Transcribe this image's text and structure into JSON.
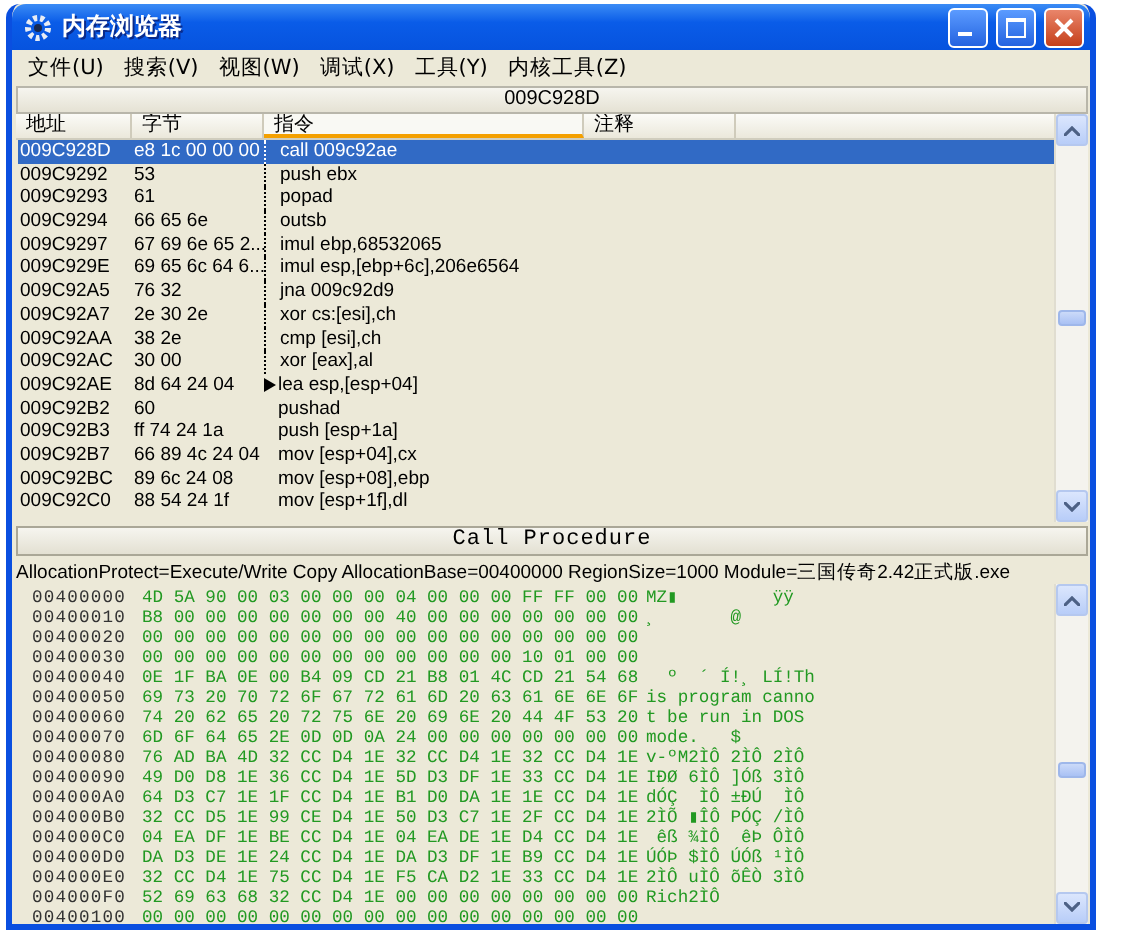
{
  "window": {
    "title": "内存浏览器"
  },
  "menu": [
    {
      "label": "文件(U)"
    },
    {
      "label": "搜索(V)"
    },
    {
      "label": "视图(W)"
    },
    {
      "label": "调试(X)"
    },
    {
      "label": "工具(Y)"
    },
    {
      "label": "内核工具(Z)"
    }
  ],
  "disassembler": {
    "address": "009C928D",
    "columns": [
      {
        "label": "地址",
        "highlighted": false
      },
      {
        "label": "字节",
        "highlighted": false
      },
      {
        "label": "指令",
        "highlighted": true
      },
      {
        "label": "注释",
        "highlighted": false
      }
    ],
    "rows": [
      {
        "address": "009C928D",
        "bytes": "e8 1c 00 00 00",
        "instruction": "call 009c92ae",
        "selected": true,
        "jump_line": true,
        "jump_target": false
      },
      {
        "address": "009C9292",
        "bytes": "53",
        "instruction": "push ebx",
        "selected": false,
        "jump_line": true,
        "jump_target": false
      },
      {
        "address": "009C9293",
        "bytes": "61",
        "instruction": "popad",
        "selected": false,
        "jump_line": true,
        "jump_target": false
      },
      {
        "address": "009C9294",
        "bytes": "66 65 6e",
        "instruction": "outsb",
        "selected": false,
        "jump_line": true,
        "jump_target": false
      },
      {
        "address": "009C9297",
        "bytes": "67 69 6e 65 2...",
        "instruction": "imul ebp,68532065",
        "selected": false,
        "jump_line": true,
        "jump_target": false
      },
      {
        "address": "009C929E",
        "bytes": "69 65 6c 64 6...",
        "instruction": "imul esp,[ebp+6c],206e6564",
        "selected": false,
        "jump_line": true,
        "jump_target": false
      },
      {
        "address": "009C92A5",
        "bytes": "76 32",
        "instruction": "jna 009c92d9",
        "selected": false,
        "jump_line": true,
        "jump_target": false
      },
      {
        "address": "009C92A7",
        "bytes": "2e 30 2e",
        "instruction": "xor cs:[esi],ch",
        "selected": false,
        "jump_line": true,
        "jump_target": false
      },
      {
        "address": "009C92AA",
        "bytes": "38 2e",
        "instruction": "cmp [esi],ch",
        "selected": false,
        "jump_line": true,
        "jump_target": false
      },
      {
        "address": "009C92AC",
        "bytes": "30 00",
        "instruction": "xor [eax],al",
        "selected": false,
        "jump_line": true,
        "jump_target": false
      },
      {
        "address": "009C92AE",
        "bytes": "8d 64 24 04",
        "instruction": "lea esp,[esp+04]",
        "selected": false,
        "jump_line": false,
        "jump_target": true
      },
      {
        "address": "009C92B2",
        "bytes": "60",
        "instruction": "pushad",
        "selected": false,
        "jump_line": false,
        "jump_target": false
      },
      {
        "address": "009C92B3",
        "bytes": "ff 74 24 1a",
        "instruction": "push [esp+1a]",
        "selected": false,
        "jump_line": false,
        "jump_target": false
      },
      {
        "address": "009C92B7",
        "bytes": "66 89 4c 24 04",
        "instruction": "mov [esp+04],cx",
        "selected": false,
        "jump_line": false,
        "jump_target": false
      },
      {
        "address": "009C92BC",
        "bytes": "89 6c 24 08",
        "instruction": "mov [esp+08],ebp",
        "selected": false,
        "jump_line": false,
        "jump_target": false
      },
      {
        "address": "009C92C0",
        "bytes": "88 54 24 1f",
        "instruction": "mov [esp+1f],dl",
        "selected": false,
        "jump_line": false,
        "jump_target": false
      }
    ]
  },
  "section_bar": {
    "label": "Call Procedure"
  },
  "hex": {
    "info": "AllocationProtect=Execute/Write Copy  AllocationBase=00400000 RegionSize=1000 Module=三国传奇2.42正式版.exe",
    "rows": [
      {
        "address": "00400000",
        "bytes": "4D 5A 90 00 03 00 00 00 04 00 00 00 FF FF 00 00",
        "ascii": "MZ▮         ÿÿ"
      },
      {
        "address": "00400010",
        "bytes": "B8 00 00 00 00 00 00 00 40 00 00 00 00 00 00 00",
        "ascii": "¸       @"
      },
      {
        "address": "00400020",
        "bytes": "00 00 00 00 00 00 00 00 00 00 00 00 00 00 00 00"
      },
      {
        "address": "00400030",
        "bytes": "00 00 00 00 00 00 00 00 00 00 00 00 10 01 00 00"
      },
      {
        "address": "00400040",
        "bytes": "0E 1F BA 0E 00 B4 09 CD 21 B8 01 4C CD 21 54 68",
        "ascii": "  º  ´ Í!¸ LÍ!Th"
      },
      {
        "address": "00400050",
        "bytes": "69 73 20 70 72 6F 67 72 61 6D 20 63 61 6E 6E 6F",
        "ascii": "is program canno"
      },
      {
        "address": "00400060",
        "bytes": "74 20 62 65 20 72 75 6E 20 69 6E 20 44 4F 53 20",
        "ascii": "t be run in DOS"
      },
      {
        "address": "00400070",
        "bytes": "6D 6F 64 65 2E 0D 0D 0A 24 00 00 00 00 00 00 00",
        "ascii": "mode.   $"
      },
      {
        "address": "00400080",
        "bytes": "76 AD BA 4D 32 CC D4 1E 32 CC D4 1E 32 CC D4 1E",
        "ascii": "v-ºM2ÌÔ 2ÌÔ 2ÌÔ"
      },
      {
        "address": "00400090",
        "bytes": "49 D0 D8 1E 36 CC D4 1E 5D D3 DF 1E 33 CC D4 1E",
        "ascii": "IÐØ 6ÌÔ ]Óß 3ÌÔ"
      },
      {
        "address": "004000A0",
        "bytes": "64 D3 C7 1E 1F CC D4 1E B1 D0 DA 1E 1E CC D4 1E",
        "ascii": "dÓÇ  ÌÔ ±ÐÚ  ÌÔ"
      },
      {
        "address": "004000B0",
        "bytes": "32 CC D5 1E 99 CE D4 1E 50 D3 C7 1E 2F CC D4 1E",
        "ascii": "2ÌÕ ▮ÎÔ PÓÇ /ÌÔ"
      },
      {
        "address": "004000C0",
        "bytes": "04 EA DF 1E BE CC D4 1E 04 EA DE 1E D4 CC D4 1E",
        "ascii": " êß ¾ÌÔ  êÞ ÔÌÔ"
      },
      {
        "address": "004000D0",
        "bytes": "DA D3 DE 1E 24 CC D4 1E DA D3 DF 1E B9 CC D4 1E",
        "ascii": "ÚÓÞ $ÌÔ ÚÓß ¹ÌÔ"
      },
      {
        "address": "004000E0",
        "bytes": "32 CC D4 1E 75 CC D4 1E F5 CA D2 1E 33 CC D4 1E",
        "ascii": "2ÌÔ uÌÔ õÊÒ 3ÌÔ"
      },
      {
        "address": "004000F0",
        "bytes": "52 69 63 68 32 CC D4 1E 00 00 00 00 00 00 00 00",
        "ascii": "Rich2ÌÔ"
      },
      {
        "address": "00400100",
        "bytes": "00 00 00 00 00 00 00 00 00 00 00 00 00 00 00 00"
      }
    ]
  }
}
